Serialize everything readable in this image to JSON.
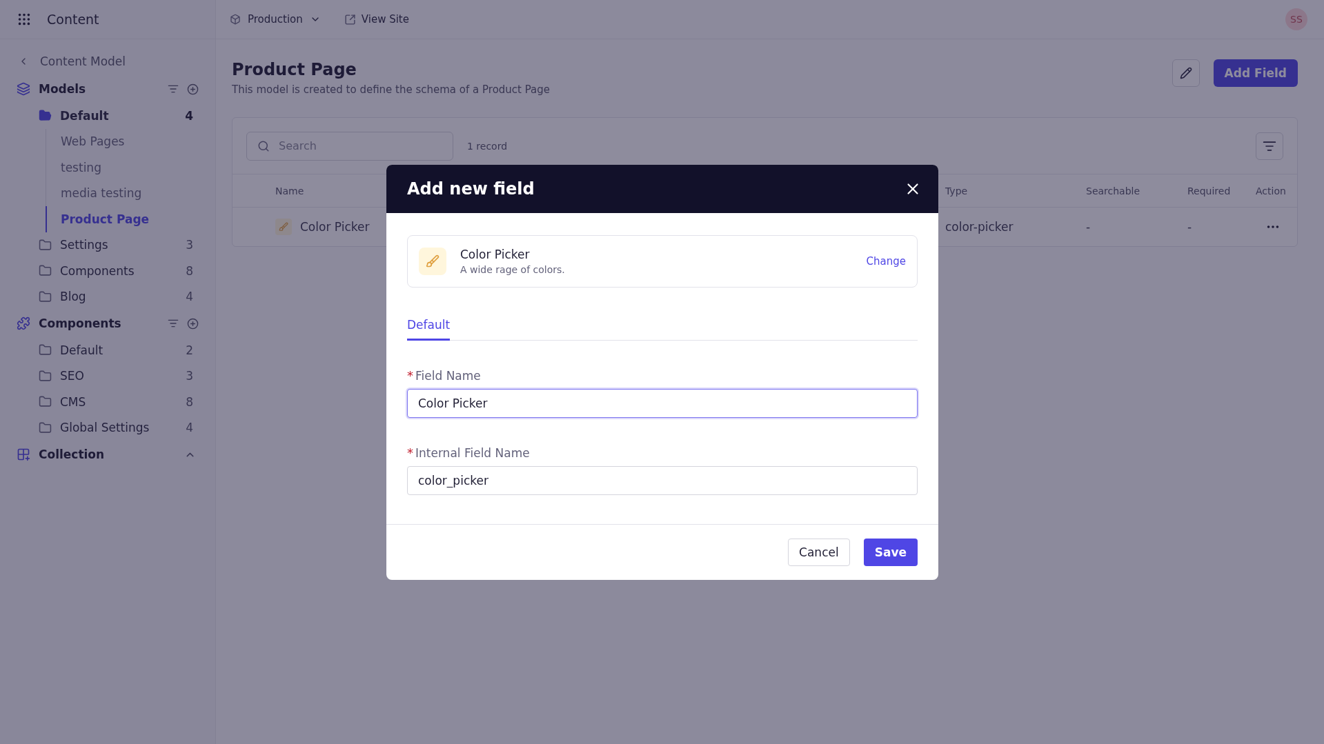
{
  "app": {
    "title": "Content"
  },
  "topbar": {
    "environment": "Production",
    "view_site": "View Site",
    "avatar": "SS"
  },
  "sidebar": {
    "back": "Content Model",
    "sections": [
      {
        "title": "Models",
        "kind": "group",
        "folders": [
          {
            "label": "Default",
            "count": "4",
            "expanded": true,
            "children": [
              {
                "label": "Web Pages",
                "selected": false
              },
              {
                "label": "testing",
                "selected": false
              },
              {
                "label": "media testing",
                "selected": false
              },
              {
                "label": "Product Page",
                "selected": true
              }
            ]
          },
          {
            "label": "Settings",
            "count": "3",
            "expanded": false
          },
          {
            "label": "Components",
            "count": "8",
            "expanded": false
          },
          {
            "label": "Blog",
            "count": "4",
            "expanded": false
          }
        ]
      },
      {
        "title": "Components",
        "kind": "group",
        "folders": [
          {
            "label": "Default",
            "count": "2",
            "expanded": false
          },
          {
            "label": "SEO",
            "count": "3",
            "expanded": false
          },
          {
            "label": "CMS",
            "count": "8",
            "expanded": false
          },
          {
            "label": "Global Settings",
            "count": "4",
            "expanded": false
          }
        ]
      },
      {
        "title": "Collection",
        "kind": "collapsible"
      }
    ]
  },
  "page": {
    "title": "Product Page",
    "description": "This model is created to define the schema of a Product Page",
    "add_button": "Add Field"
  },
  "table": {
    "search_placeholder": "Search",
    "record_count": "1 record",
    "columns": [
      {
        "label": "Name"
      },
      {
        "label": "Type"
      },
      {
        "label": "Searchable"
      },
      {
        "label": "Required"
      },
      {
        "label": "Action"
      }
    ],
    "rows": [
      {
        "name": "Color Picker",
        "type": "color-picker",
        "searchable": "-",
        "required": "-"
      }
    ]
  },
  "modal": {
    "title": "Add new field",
    "field_type": {
      "name": "Color Picker",
      "description": "A wide rage of colors.",
      "change": "Change"
    },
    "tabs": [
      {
        "label": "Default",
        "selected": true
      }
    ],
    "required_mark": "*",
    "fields": [
      {
        "label": "Field Name",
        "required": true,
        "value": "Color Picker",
        "focused": true
      },
      {
        "label": "Internal Field Name",
        "required": true,
        "value": "color_picker",
        "focused": false
      }
    ],
    "cancel": "Cancel",
    "save": "Save"
  }
}
